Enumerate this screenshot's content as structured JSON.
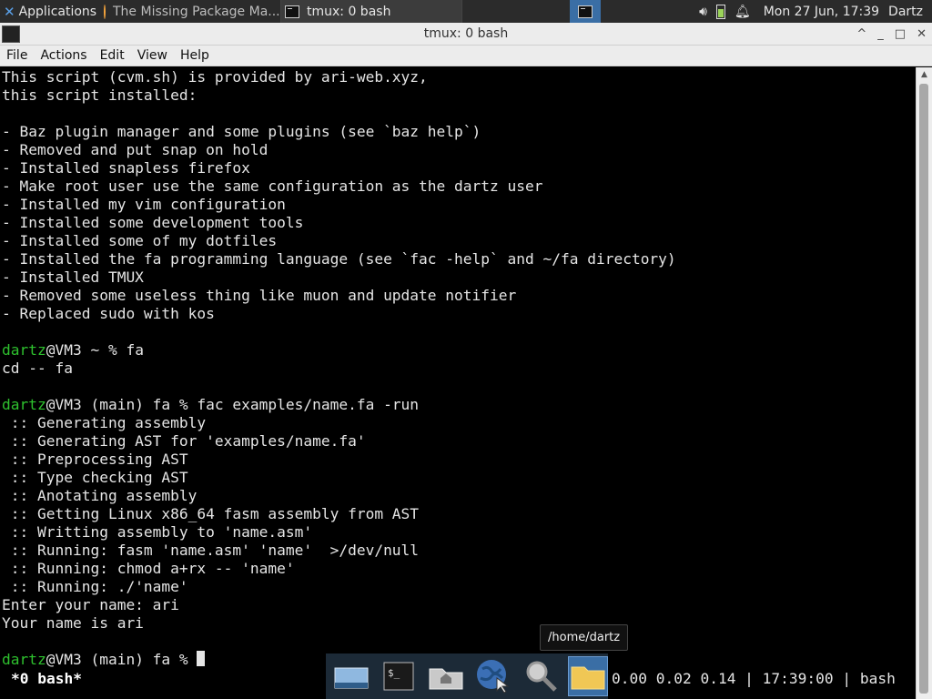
{
  "top_panel": {
    "apps_label": "Applications",
    "task_firefox": "The Missing Package Ma...",
    "task_tmux": "tmux: 0 bash",
    "clock": "Mon 27 Jun, 17:39",
    "user": "Dartz"
  },
  "window": {
    "title": "tmux: 0 bash",
    "minimize": "_",
    "maximize": "□",
    "close": "✕",
    "shade": "^"
  },
  "menu": [
    "File",
    "Actions",
    "Edit",
    "View",
    "Help"
  ],
  "terminal": {
    "lines": [
      {
        "text": "This script (cvm.sh) is provided by ari-web.xyz,"
      },
      {
        "text": "this script installed:"
      },
      {
        "text": ""
      },
      {
        "text": "- Baz plugin manager and some plugins (see `baz help`)"
      },
      {
        "text": "- Removed and put snap on hold"
      },
      {
        "text": "- Installed snapless firefox"
      },
      {
        "text": "- Make root user use the same configuration as the dartz user"
      },
      {
        "text": "- Installed my vim configuration"
      },
      {
        "text": "- Installed some development tools"
      },
      {
        "text": "- Installed some of my dotfiles"
      },
      {
        "text": "- Installed the fa programming language (see `fac -help` and ~/fa directory)"
      },
      {
        "text": "- Installed TMUX"
      },
      {
        "text": "- Removed some useless thing like muon and update notifier"
      },
      {
        "text": "- Replaced sudo with kos"
      },
      {
        "text": ""
      },
      {
        "prompt_user": "dartz",
        "text": "@VM3 ~ % fa"
      },
      {
        "text": "cd -- fa"
      },
      {
        "text": ""
      },
      {
        "prompt_user": "dartz",
        "text": "@VM3 (main) fa % fac examples/name.fa -run"
      },
      {
        "text": " :: Generating assembly"
      },
      {
        "text": " :: Generating AST for 'examples/name.fa'"
      },
      {
        "text": " :: Preprocessing AST"
      },
      {
        "text": " :: Type checking AST"
      },
      {
        "text": " :: Anotating assembly"
      },
      {
        "text": " :: Getting Linux x86_64 fasm assembly from AST"
      },
      {
        "text": " :: Writting assembly to 'name.asm'"
      },
      {
        "text": " :: Running: fasm 'name.asm' 'name'  >/dev/null"
      },
      {
        "text": " :: Running: chmod a+rx -- 'name'"
      },
      {
        "text": " :: Running: ./'name'"
      },
      {
        "text": "Enter your name: ari"
      },
      {
        "text": "Your name is ari"
      },
      {
        "text": ""
      },
      {
        "prompt_user": "dartz",
        "text": "@VM3 (main) fa % "
      }
    ],
    "status_left": "*0 bash*",
    "status_right": "0.00 0.02 0.14 | 17:39:00 | bash"
  },
  "dock": {
    "tooltip": "/home/dartz",
    "items": [
      "desktop-icon",
      "terminal-icon",
      "home-folder-icon",
      "browser-icon",
      "search-icon",
      "folder-icon"
    ]
  },
  "colors": {
    "prompt": "#2ec02e",
    "panel": "#2b2b2b",
    "dock": "#1c2a37",
    "selected": "#3a6ea5"
  }
}
